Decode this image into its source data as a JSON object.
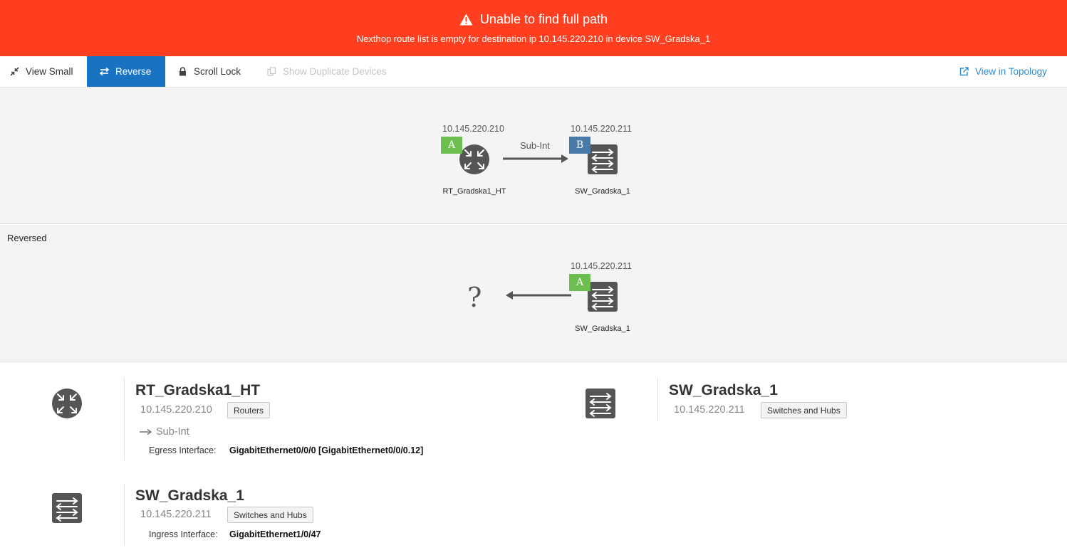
{
  "banner": {
    "title": "Unable to find full path",
    "message": "Nexthop route list is empty for destination ip 10.145.220.210 in device SW_Gradska_1",
    "icon": "warning-icon",
    "color": "#ff3f1f"
  },
  "toolbar": {
    "view_small": "View Small",
    "reverse": "Reverse",
    "scroll_lock": "Scroll Lock",
    "show_duplicates": "Show Duplicate Devices",
    "view_topology": "View in Topology",
    "active_color": "#1a73c2"
  },
  "path": {
    "source": {
      "ip": "10.145.220.210",
      "badge": "A",
      "name": "RT_Gradska1_HT",
      "icon": "router-icon"
    },
    "link_label": "Sub-Int",
    "dest": {
      "ip": "10.145.220.211",
      "badge": "B",
      "name": "SW_Gradska_1",
      "icon": "switch-icon"
    }
  },
  "reversed": {
    "label": "Reversed",
    "source": {
      "ip": "10.145.220.211",
      "badge": "A",
      "name": "SW_Gradska_1",
      "icon": "switch-icon"
    },
    "unknown": "?"
  },
  "details": [
    {
      "name": "RT_Gradska1_HT",
      "ip": "10.145.220.210",
      "type": "Routers",
      "link": "Sub-Int",
      "iface_label": "Egress Interface:",
      "iface_value": "GigabitEthernet0/0/0 [GigabitEthernet0/0/0.12]"
    },
    {
      "name": "SW_Gradska_1",
      "ip": "10.145.220.211",
      "type": "Switches and Hubs"
    },
    {
      "name": "SW_Gradska_1",
      "ip": "10.145.220.211",
      "type": "Switches and Hubs",
      "iface_label": "Ingress Interface:",
      "iface_value": "GigabitEthernet1/0/47"
    }
  ]
}
